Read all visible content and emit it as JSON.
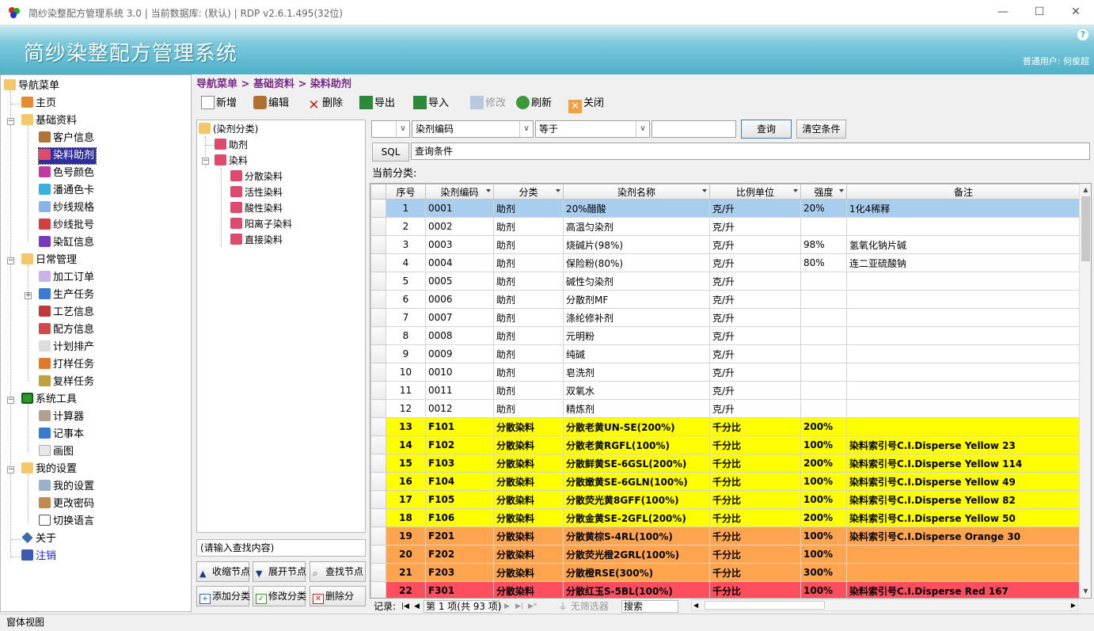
{
  "window": {
    "title": "简纱染整配方管理系统 3.0 | 当前数据库: (默认) | RDP v2.6.1.495(32位)",
    "minimize": "—",
    "maximize": "☐",
    "close": "✕"
  },
  "banner": {
    "title": "简纱染整配方管理系统",
    "user": "普通用户: 何俊超",
    "help": "?"
  },
  "nav": {
    "root": "导航菜单",
    "home": "主页",
    "basic": "基础资料",
    "basic_items": [
      "客户信息",
      "染料助剂",
      "色号颜色",
      "潘通色卡",
      "纱线规格",
      "纱线批号",
      "染缸信息"
    ],
    "daily": "日常管理",
    "daily_items": [
      "加工订单",
      "生产任务",
      "工艺信息",
      "配方信息",
      "计划排产",
      "打样任务",
      "复样任务"
    ],
    "tools": "系统工具",
    "tools_items": [
      "计算器",
      "记事本",
      "画图"
    ],
    "settings": "我的设置",
    "settings_items": [
      "我的设置",
      "更改密码",
      "切换语言"
    ],
    "about": "关于",
    "logout": "注销"
  },
  "breadcrumb": "导航菜单 > 基础资料 > 染料助剂",
  "toolbar": {
    "new": "新增",
    "edit": "编辑",
    "delete": "删除",
    "export": "导出",
    "import": "导入",
    "modify": "修改",
    "refresh": "刷新",
    "close": "关闭"
  },
  "categories": {
    "root": "(染剂分类)",
    "aux": "助剂",
    "dye": "染料",
    "dye_items": [
      "分散染料",
      "活性染料",
      "酸性染料",
      "阳离子染料",
      "直接染料"
    ]
  },
  "cat_search": "(请输入查找内容)",
  "cat_buttons": {
    "collapse": "收缩节点",
    "expand": "展开节点",
    "find": "查找节点",
    "add": "添加分类",
    "modify": "修改分类",
    "remove": "删除分"
  },
  "filter": {
    "field": "染剂编码",
    "op": "等于",
    "value": "",
    "query": "查询",
    "clear": "清空条件",
    "sql": "SQL",
    "condition": "查询条件"
  },
  "current_class": "当前分类:",
  "grid": {
    "headers": [
      "序号",
      "染剂编码",
      "分类",
      "染剂名称",
      "比例单位",
      "强度",
      "备注"
    ],
    "rows": [
      [
        "1",
        "0001",
        "助剂",
        "20%醋酸",
        "克/升",
        "20%",
        "1化4稀释"
      ],
      [
        "2",
        "0002",
        "助剂",
        "高温匀染剂",
        "克/升",
        "",
        ""
      ],
      [
        "3",
        "0003",
        "助剂",
        "烧碱片(98%)",
        "克/升",
        "98%",
        "氢氧化钠片碱"
      ],
      [
        "4",
        "0004",
        "助剂",
        "保险粉(80%)",
        "克/升",
        "80%",
        "连二亚硫酸钠"
      ],
      [
        "5",
        "0005",
        "助剂",
        "碱性匀染剂",
        "克/升",
        "",
        ""
      ],
      [
        "6",
        "0006",
        "助剂",
        "分散剂MF",
        "克/升",
        "",
        ""
      ],
      [
        "7",
        "0007",
        "助剂",
        "涤纶修补剂",
        "克/升",
        "",
        ""
      ],
      [
        "8",
        "0008",
        "助剂",
        "元明粉",
        "克/升",
        "",
        ""
      ],
      [
        "9",
        "0009",
        "助剂",
        "纯碱",
        "克/升",
        "",
        ""
      ],
      [
        "10",
        "0010",
        "助剂",
        "皂洗剂",
        "克/升",
        "",
        ""
      ],
      [
        "11",
        "0011",
        "助剂",
        "双氧水",
        "克/升",
        "",
        ""
      ],
      [
        "12",
        "0012",
        "助剂",
        "精炼剂",
        "克/升",
        "",
        ""
      ],
      [
        "13",
        "F101",
        "分散染料",
        "分散老黄UN-SE(200%)",
        "千分比",
        "200%",
        ""
      ],
      [
        "14",
        "F102",
        "分散染料",
        "分散老黄RGFL(100%)",
        "千分比",
        "100%",
        "染料索引号C.I.Disperse Yellow 23"
      ],
      [
        "15",
        "F103",
        "分散染料",
        "分散鲜黄SE-6GSL(200%)",
        "千分比",
        "200%",
        "染料索引号C.I.Disperse Yellow 114"
      ],
      [
        "16",
        "F104",
        "分散染料",
        "分散嫩黄SE-6GLN(100%)",
        "千分比",
        "100%",
        "染料索引号C.I.Disperse Yellow 49"
      ],
      [
        "17",
        "F105",
        "分散染料",
        "分散荧光黄8GFF(100%)",
        "千分比",
        "100%",
        "染料索引号C.I.Disperse Yellow 82"
      ],
      [
        "18",
        "F106",
        "分散染料",
        "分散金黄SE-2GFL(200%)",
        "千分比",
        "200%",
        "染料索引号C.I.Disperse Yellow 50"
      ],
      [
        "19",
        "F201",
        "分散染料",
        "分散黄棕S-4RL(100%)",
        "千分比",
        "100%",
        "染料索引号C.I.Disperse Orange 30"
      ],
      [
        "20",
        "F202",
        "分散染料",
        "分散荧光橙2GRL(100%)",
        "千分比",
        "100%",
        ""
      ],
      [
        "21",
        "F203",
        "分散染料",
        "分散橙RSE(300%)",
        "千分比",
        "300%",
        ""
      ],
      [
        "22",
        "F301",
        "分散染料",
        "分散红玉S-5BL(100%)",
        "千分比",
        "100%",
        "染料索引号C.I.Disperse Red 167"
      ]
    ],
    "row_colors": [
      "#a8cdee",
      "#ffffff",
      "#ffffff",
      "#ffffff",
      "#ffffff",
      "#ffffff",
      "#ffffff",
      "#ffffff",
      "#ffffff",
      "#ffffff",
      "#ffffff",
      "#ffffff",
      "#ffff00",
      "#ffff00",
      "#ffff00",
      "#ffff00",
      "#ffff00",
      "#ffff00",
      "#ffa54f",
      "#ffa54f",
      "#ffa54f",
      "#ff4f5e"
    ]
  },
  "pager": {
    "label": "记录:",
    "page": "第 1 项(共 93 项)",
    "nofilter": "无筛选器",
    "search": "搜索"
  },
  "statusbar": "窗体视图"
}
